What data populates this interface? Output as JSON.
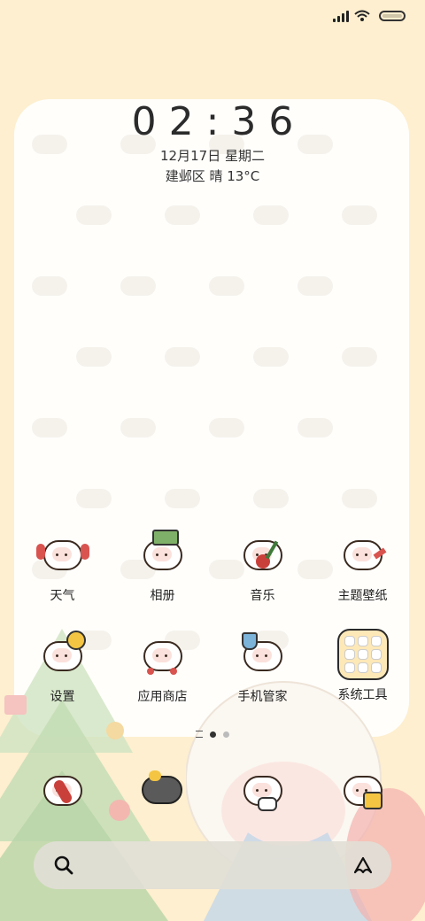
{
  "status_bar": {
    "signal_icon": "signal-icon",
    "wifi_icon": "wifi-icon",
    "battery_icon": "battery-icon"
  },
  "clock": {
    "time": "02:36",
    "date": "12月17日 星期二",
    "weather": "建邺区 晴 13°C"
  },
  "apps_row1": [
    {
      "label": "天气",
      "icon": "weather-sheep-icon"
    },
    {
      "label": "相册",
      "icon": "gallery-sheep-icon"
    },
    {
      "label": "音乐",
      "icon": "music-sheep-icon"
    },
    {
      "label": "主题壁纸",
      "icon": "theme-sheep-icon"
    }
  ],
  "apps_row2": [
    {
      "label": "设置",
      "icon": "settings-sheep-icon"
    },
    {
      "label": "应用商店",
      "icon": "app-store-sheep-icon"
    },
    {
      "label": "手机管家",
      "icon": "security-sheep-icon"
    },
    {
      "label": "系统工具",
      "icon": "system-tools-folder-icon"
    }
  ],
  "dock": [
    {
      "icon": "phone-sheep-icon"
    },
    {
      "icon": "contacts-mouse-icon"
    },
    {
      "icon": "messages-sheep-icon"
    },
    {
      "icon": "camera-sheep-icon"
    }
  ],
  "page_indicator": {
    "pages": 2,
    "current": 1
  },
  "colors": {
    "background": "#fdefcf",
    "panel": "#fffefb",
    "search_bar": "#e1ded6"
  }
}
